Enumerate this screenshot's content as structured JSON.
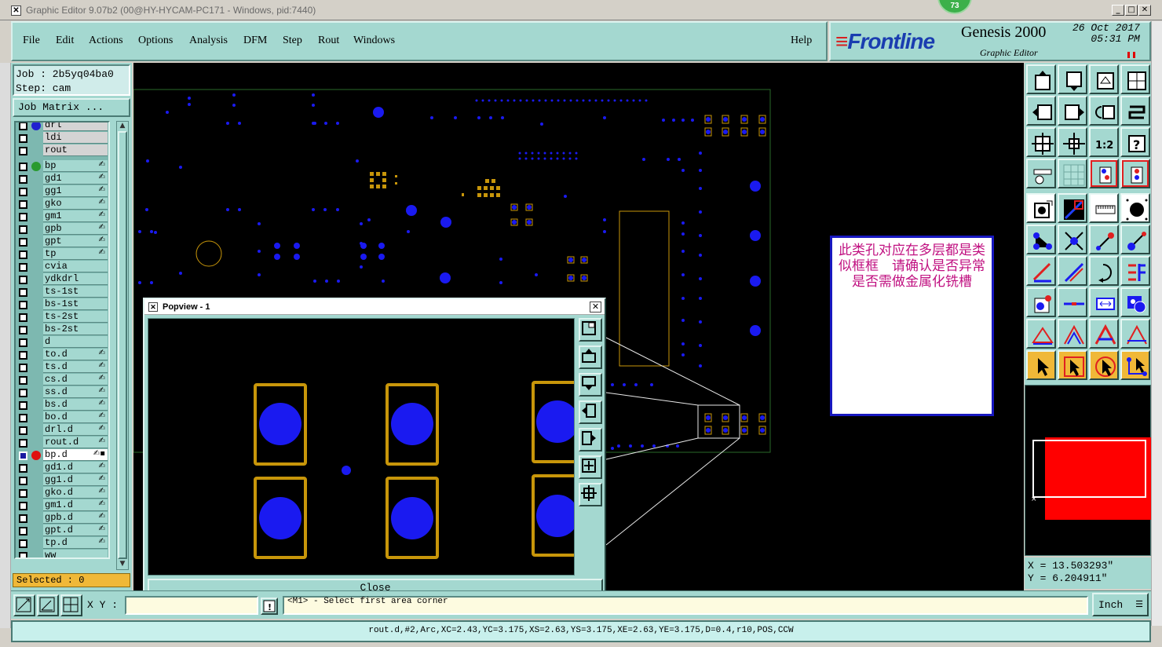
{
  "window": {
    "title": "Graphic Editor 9.07b2 (00@HY-HYCAM-PC171 - Windows, pid:7440)",
    "badge": "73"
  },
  "menu": {
    "file": "File",
    "edit": "Edit",
    "actions": "Actions",
    "options": "Options",
    "analysis": "Analysis",
    "dfm": "DFM",
    "step": "Step",
    "rout": "Rout",
    "windows": "Windows",
    "help": "Help"
  },
  "brand": {
    "logo": "Frontline",
    "product": "Genesis 2000",
    "subtitle": "Graphic Editor",
    "date": "26 Oct 2017",
    "time": "05:31 PM"
  },
  "job": {
    "job_line": "Job : 2b5yq04ba0",
    "step_line": "Step: cam",
    "matrix_button": "Job Matrix ..."
  },
  "layers": [
    {
      "name": "drl",
      "dot": "#2020d0",
      "grey": true
    },
    {
      "name": "ldi",
      "grey": true
    },
    {
      "name": "rout",
      "grey": true
    },
    {
      "name": "bp",
      "dot": "#2a9a30",
      "flag": "✍"
    },
    {
      "name": "gd1",
      "flag": "✍"
    },
    {
      "name": "gg1",
      "flag": "✍"
    },
    {
      "name": "gko",
      "flag": "✍"
    },
    {
      "name": "gm1",
      "flag": "✍"
    },
    {
      "name": "gpb",
      "flag": "✍"
    },
    {
      "name": "gpt",
      "flag": "✍"
    },
    {
      "name": "tp",
      "flag": "✍"
    },
    {
      "name": "cvia"
    },
    {
      "name": "ydkdrl"
    },
    {
      "name": "ts-1st"
    },
    {
      "name": "bs-1st"
    },
    {
      "name": "ts-2st"
    },
    {
      "name": "bs-2st"
    },
    {
      "name": "d"
    },
    {
      "name": "to.d",
      "flag": "✍"
    },
    {
      "name": "ts.d",
      "flag": "✍"
    },
    {
      "name": "cs.d",
      "flag": "✍"
    },
    {
      "name": "ss.d",
      "flag": "✍"
    },
    {
      "name": "bs.d",
      "flag": "✍"
    },
    {
      "name": "bo.d",
      "flag": "✍"
    },
    {
      "name": "drl.d",
      "flag": "✍"
    },
    {
      "name": "rout.d",
      "flag": "✍"
    },
    {
      "name": "bp.d",
      "dot": "#e01010",
      "selected": true,
      "flag": "✍▪"
    },
    {
      "name": "gd1.d",
      "flag": "✍"
    },
    {
      "name": "gg1.d",
      "flag": "✍"
    },
    {
      "name": "gko.d",
      "flag": "✍"
    },
    {
      "name": "gm1.d",
      "flag": "✍"
    },
    {
      "name": "gpb.d",
      "flag": "✍"
    },
    {
      "name": "gpt.d",
      "flag": "✍"
    },
    {
      "name": "tp.d",
      "flag": "✍"
    },
    {
      "name": "ww"
    }
  ],
  "selected_label": "Selected : 0",
  "annotation": "此类孔对应在多层都是类似框框　请确认是否异常　是否需做金属化铣槽",
  "popview": {
    "title": "Popview - 1",
    "close_label": "Close"
  },
  "coords": {
    "x_line": "X = 13.503293\"",
    "y_line": "Y = 6.204911\""
  },
  "bottom": {
    "xy_label": "X Y :",
    "xy_value": "",
    "message": "<M1> - Select first area corner",
    "unit": "Inch"
  },
  "status_line": "rout.d,#2,Arc,XC=2.43,YC=3.175,XS=2.63,YS=3.175,XE=2.63,YE=3.175,D=0.4,r10,POS,CCW",
  "colors": {
    "panel": "#a4d8d0",
    "pad": "#1a1af0",
    "outline": "#c8960a",
    "board_outline": "#2a6a2a"
  }
}
